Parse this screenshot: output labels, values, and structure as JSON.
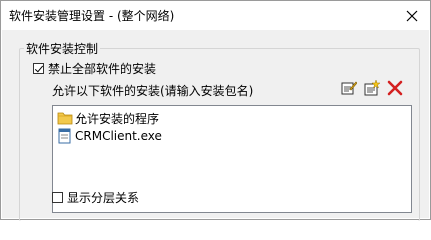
{
  "window": {
    "title": "软件安装管理设置 - (整个网络)"
  },
  "group": {
    "label": "软件安装控制"
  },
  "forbid_all": {
    "label": "禁止全部软件的安装",
    "checked": true
  },
  "allow_list": {
    "label": "允许以下软件的安装(请输入安装包名)",
    "items": [
      {
        "label": "允许安装的程序",
        "icon": "folder-icon"
      },
      {
        "label": "CRMClient.exe",
        "icon": "program-icon"
      }
    ]
  },
  "toolbar": {
    "icons": [
      "edit-icon",
      "add-icon",
      "delete-icon"
    ]
  },
  "show_hierarchy": {
    "label": "显示分层关系",
    "checked": false
  },
  "colors": {
    "delete": "#d42020",
    "folder": "#f2c94c"
  }
}
